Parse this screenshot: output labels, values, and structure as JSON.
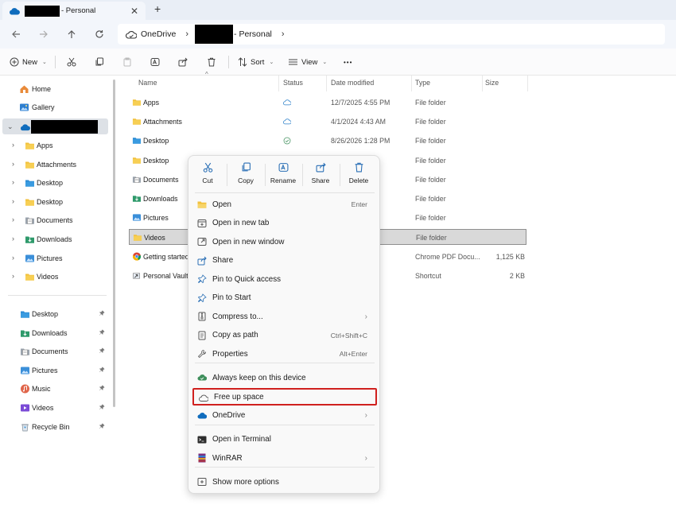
{
  "tab": {
    "title": "- Personal",
    "close": "✕",
    "new_tab": "+"
  },
  "address": {
    "root": "OneDrive",
    "current": "- Personal",
    "sep": "›"
  },
  "commands": {
    "new": "New",
    "sort": "Sort",
    "view": "View",
    "more": "•••"
  },
  "sidebar": {
    "top": [
      {
        "label": "Home",
        "icon": "home-icon"
      },
      {
        "label": "Gallery",
        "icon": "gallery-icon"
      }
    ],
    "tree": [
      {
        "label": "Apps",
        "icon": "folder-icon"
      },
      {
        "label": "Attachments",
        "icon": "folder-icon"
      },
      {
        "label": "Desktop",
        "icon": "desktop-folder-icon"
      },
      {
        "label": "Desktop",
        "icon": "folder-icon"
      },
      {
        "label": "Documents",
        "icon": "documents-icon"
      },
      {
        "label": "Downloads",
        "icon": "downloads-icon"
      },
      {
        "label": "Pictures",
        "icon": "pictures-icon"
      },
      {
        "label": "Videos",
        "icon": "folder-icon"
      }
    ],
    "quick": [
      {
        "label": "Desktop",
        "icon": "desktop-folder-icon"
      },
      {
        "label": "Downloads",
        "icon": "downloads-icon"
      },
      {
        "label": "Documents",
        "icon": "documents-icon"
      },
      {
        "label": "Pictures",
        "icon": "pictures-icon"
      },
      {
        "label": "Music",
        "icon": "music-icon"
      },
      {
        "label": "Videos",
        "icon": "videos-icon"
      },
      {
        "label": "Recycle Bin",
        "icon": "recycle-bin-icon"
      }
    ]
  },
  "columns": {
    "name": "Name",
    "status": "Status",
    "date": "Date modified",
    "type": "Type",
    "size": "Size"
  },
  "files": [
    {
      "name": "Apps",
      "status": "cloud",
      "date": "12/7/2025 4:55 PM",
      "type": "File folder",
      "size": ""
    },
    {
      "name": "Attachments",
      "status": "cloud",
      "date": "4/1/2024 4:43 AM",
      "type": "File folder",
      "size": ""
    },
    {
      "name": "Desktop",
      "status": "synced",
      "date": "8/26/2026 1:28 PM",
      "type": "File folder",
      "size": ""
    },
    {
      "name": "Desktop",
      "status": "",
      "date": "AM",
      "type": "File folder",
      "size": ""
    },
    {
      "name": "Documents",
      "status": "",
      "date": "PM",
      "type": "File folder",
      "size": ""
    },
    {
      "name": "Downloads",
      "status": "",
      "date": "PM",
      "type": "File folder",
      "size": ""
    },
    {
      "name": "Pictures",
      "status": "",
      "date": "PM",
      "type": "File folder",
      "size": ""
    },
    {
      "name": "Videos",
      "status": "",
      "date": "PM",
      "type": "File folder",
      "size": ""
    },
    {
      "name": "Getting started",
      "status": "",
      "date": "9 PM",
      "type": "Chrome PDF Docu...",
      "size": "1,125 KB"
    },
    {
      "name": "Personal Vault",
      "status": "",
      "date": "PM",
      "type": "Shortcut",
      "size": "2 KB"
    }
  ],
  "context_menu": {
    "quick_actions": [
      {
        "label": "Cut",
        "icon": "cut-icon"
      },
      {
        "label": "Copy",
        "icon": "copy-icon"
      },
      {
        "label": "Rename",
        "icon": "rename-icon"
      },
      {
        "label": "Share",
        "icon": "share-icon"
      },
      {
        "label": "Delete",
        "icon": "delete-icon"
      }
    ],
    "items": [
      {
        "label": "Open",
        "key": "Enter",
        "icon": "folder-open-icon"
      },
      {
        "label": "Open in new tab",
        "key": "",
        "icon": "new-tab-icon"
      },
      {
        "label": "Open in new window",
        "key": "",
        "icon": "new-window-icon"
      },
      {
        "label": "Share",
        "key": "",
        "icon": "share-icon"
      },
      {
        "label": "Pin to Quick access",
        "key": "",
        "icon": "pin-icon"
      },
      {
        "label": "Pin to Start",
        "key": "",
        "icon": "pin-start-icon"
      },
      {
        "label": "Compress to...",
        "key": "",
        "icon": "compress-icon",
        "submenu": true
      },
      {
        "label": "Copy as path",
        "key": "Ctrl+Shift+C",
        "icon": "copy-path-icon"
      },
      {
        "label": "Properties",
        "key": "Alt+Enter",
        "icon": "properties-icon"
      },
      {
        "label": "Always keep on this device",
        "key": "",
        "icon": "keep-device-icon"
      },
      {
        "label": "Free up space",
        "key": "",
        "icon": "cloud-outline-icon"
      },
      {
        "label": "OneDrive",
        "key": "",
        "icon": "onedrive-icon",
        "submenu": true
      },
      {
        "label": "Open in Terminal",
        "key": "",
        "icon": "terminal-icon"
      },
      {
        "label": "WinRAR",
        "key": "",
        "icon": "winrar-icon",
        "submenu": true
      },
      {
        "label": "Show more options",
        "key": "",
        "icon": "more-options-icon"
      }
    ],
    "submenu_glyph": "›"
  },
  "colors": {
    "accent": "#0f6cbd",
    "highlight_border": "#d0201e",
    "folder": "#f2c13d",
    "selected_row": "#d9d9d9"
  }
}
